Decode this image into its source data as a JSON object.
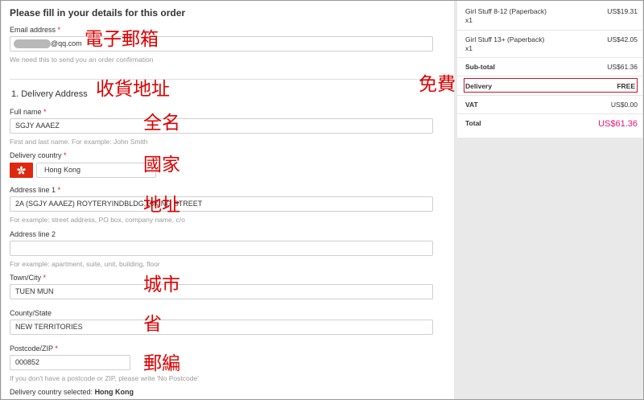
{
  "form": {
    "title": "Please fill in your details for this order",
    "email": {
      "label": "Email address",
      "required_mark": "*",
      "value_suffix": "@qq.com",
      "help": "We need this to send you an order confirmation"
    },
    "section_title": "1. Delivery Address",
    "full_name": {
      "label": "Full name",
      "required_mark": "*",
      "value": "SGJY AAAEZ",
      "help": "First and last name. For example: John Smith"
    },
    "delivery_country": {
      "label": "Delivery country",
      "required_mark": "*",
      "value": "Hong Kong"
    },
    "address_line_1": {
      "label": "Address line 1",
      "required_mark": "*",
      "value": "2A  (SGJY AAAEZ)  ROYTERYINDBLDG,15KING STREET",
      "help": "For example: street address, PO box, company name, c/o"
    },
    "address_line_2": {
      "label": "Address line 2",
      "value": "",
      "help": "For example: apartment, suite, unit, building, floor"
    },
    "town_city": {
      "label": "Town/City",
      "required_mark": "*",
      "value": "TUEN MUN"
    },
    "county_state": {
      "label": "County/State",
      "value": "NEW TERRITORIES"
    },
    "postcode": {
      "label": "Postcode/ZIP",
      "required_mark": "*",
      "value": "000852",
      "help": "If you don't have a postcode or ZIP, please write 'No Postcode'"
    },
    "selected_country": {
      "prefix": "Delivery country selected:",
      "value": "Hong Kong"
    }
  },
  "annotations": {
    "email": "電子郵箱",
    "address": "收貨地址",
    "full_name": "全名",
    "country": "國家",
    "address_line": "地址",
    "city": "城市",
    "province": "省",
    "postcode": "郵編",
    "free_delivery": "免費"
  },
  "summary": {
    "items": [
      {
        "name": "Girl Stuff 8-12 (Paperback)",
        "qty": "x1",
        "price": "US$19.31"
      },
      {
        "name": "Girl Stuff 13+ (Paperback)",
        "qty": "x1",
        "price": "US$42.05"
      }
    ],
    "subtotal": {
      "label": "Sub-total",
      "value": "US$61.36"
    },
    "delivery": {
      "label": "Delivery",
      "value": "FREE"
    },
    "vat": {
      "label": "VAT",
      "value": "US$0.00"
    },
    "total": {
      "label": "Total",
      "value": "US$61.36"
    }
  },
  "colors": {
    "annotation": "#dd0000",
    "total_price": "#e6157a",
    "flag": "#de2910",
    "delivery_box": "#c0172f"
  }
}
